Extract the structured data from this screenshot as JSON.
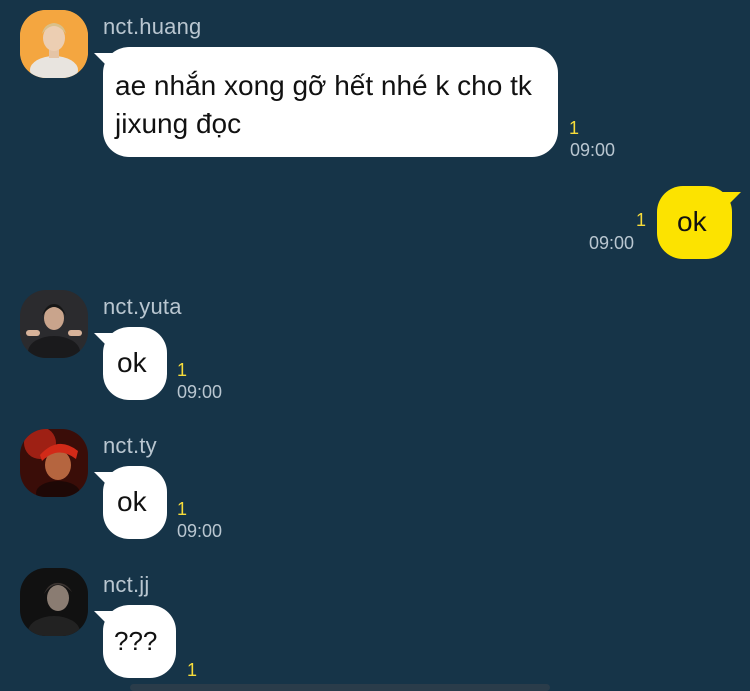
{
  "colors": {
    "background": "#163448",
    "incoming_bubble": "#ffffff",
    "outgoing_bubble": "#fce300",
    "unread": "#f7dc3a",
    "meta_text": "#b9c6d0"
  },
  "messages": [
    {
      "sender": "nct.huang",
      "avatar": "avatar-huang",
      "text": "ae nhắn xong gỡ hết nhé k cho tk jixung đọc",
      "unread": "1",
      "time": "09:00"
    },
    {
      "sender": "",
      "avatar": "",
      "text": "ok",
      "unread": "1",
      "time": "09:00",
      "outgoing": true
    },
    {
      "sender": "nct.yuta",
      "avatar": "avatar-yuta",
      "text": "ok",
      "unread": "1",
      "time": "09:00"
    },
    {
      "sender": "nct.ty",
      "avatar": "avatar-ty",
      "text": "ok",
      "unread": "1",
      "time": "09:00"
    },
    {
      "sender": "nct.jj",
      "avatar": "avatar-jj",
      "text": "???",
      "unread": "1",
      "time": ""
    }
  ]
}
